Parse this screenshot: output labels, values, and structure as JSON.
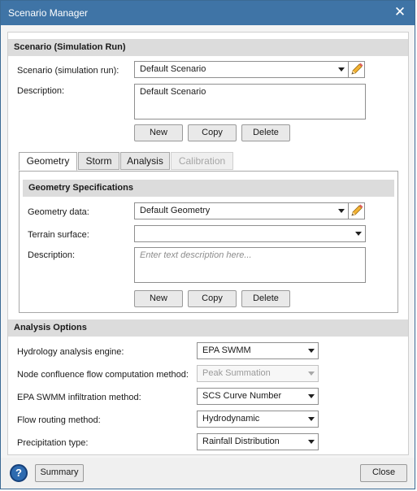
{
  "window": {
    "title": "Scenario Manager",
    "close_glyph": "✕",
    "accent": "#3f74a6"
  },
  "scenario_section": {
    "header": "Scenario (Simulation Run)",
    "scenario_label": "Scenario (simulation run):",
    "scenario_value": "Default Scenario",
    "description_label": "Description:",
    "description_value": "Default Scenario",
    "buttons": {
      "new": "New",
      "copy": "Copy",
      "delete": "Delete"
    }
  },
  "tabs": [
    {
      "label": "Geometry",
      "state": "active"
    },
    {
      "label": "Storm",
      "state": "normal"
    },
    {
      "label": "Analysis",
      "state": "normal"
    },
    {
      "label": "Calibration",
      "state": "disabled"
    }
  ],
  "geometry": {
    "header": "Geometry Specifications",
    "geometry_label": "Geometry data:",
    "geometry_value": "Default Geometry",
    "terrain_label": "Terrain surface:",
    "terrain_value": "",
    "description_label": "Description:",
    "description_placeholder": "Enter text description here...",
    "buttons": {
      "new": "New",
      "copy": "Copy",
      "delete": "Delete"
    }
  },
  "analysis_options": {
    "header": "Analysis Options",
    "rows": [
      {
        "label": "Hydrology analysis engine:",
        "value": "EPA SWMM",
        "disabled": false
      },
      {
        "label": "Node confluence flow computation method:",
        "value": "Peak Summation",
        "disabled": true
      },
      {
        "label": "EPA SWMM infiltration method:",
        "value": "SCS Curve Number",
        "disabled": false
      },
      {
        "label": "Flow routing method:",
        "value": "Hydrodynamic",
        "disabled": false
      },
      {
        "label": "Precipitation type:",
        "value": "Rainfall Distribution",
        "disabled": false
      }
    ]
  },
  "footer": {
    "help_glyph": "?",
    "summary": "Summary",
    "close": "Close"
  },
  "icons": {
    "pencil": "pencil-icon",
    "help": "help-icon",
    "dropdown": "chevron-down-icon"
  }
}
